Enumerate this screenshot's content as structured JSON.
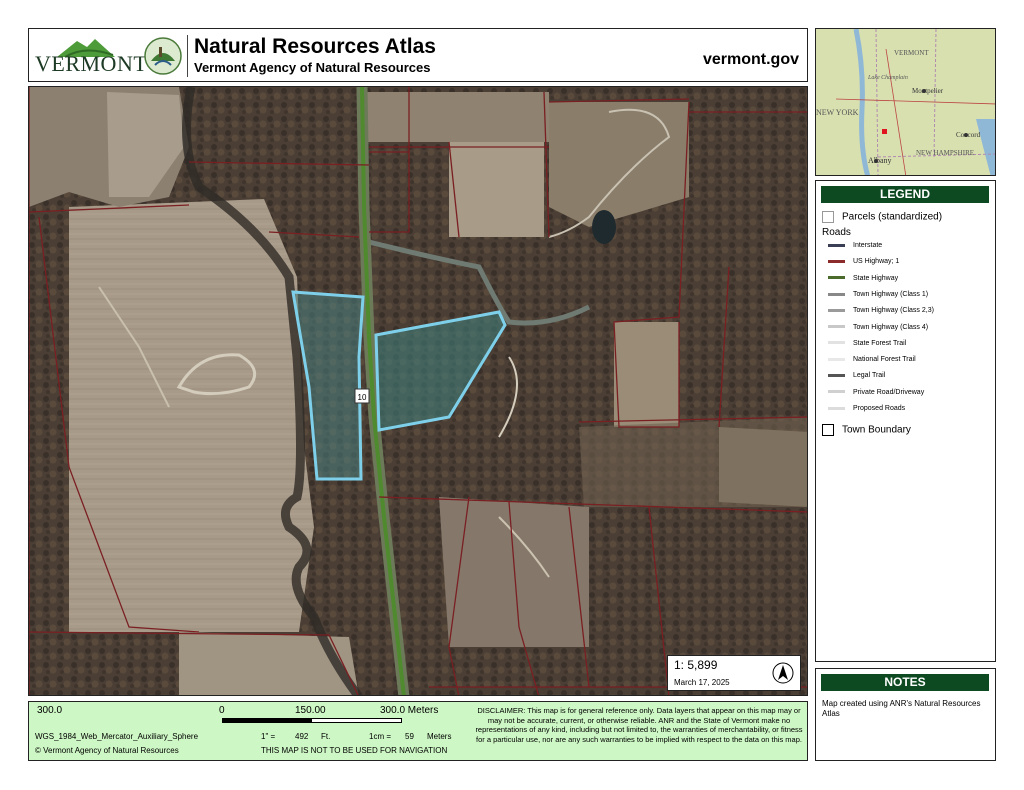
{
  "header": {
    "logo_text": "VERMONT",
    "title": "Natural Resources Atlas",
    "subtitle": "Vermont Agency of Natural Resources",
    "website": "vermont.gov"
  },
  "map": {
    "scale_ratio": "1:  5,899",
    "date": "March 17, 2025",
    "road_marker": "10"
  },
  "inset": {
    "labels": [
      "VERMONT",
      "Lake Champlain",
      "Montpelier",
      "NEW YORK",
      "Concord",
      "NEW HAMPSHIRE",
      "Albany"
    ]
  },
  "legend": {
    "title": "LEGEND",
    "parcels_label": "Parcels (standardized)",
    "roads_label": "Roads",
    "items": [
      {
        "label": "Interstate",
        "color": "#3a3f55"
      },
      {
        "label": "US Highway; 1",
        "color": "#8b2b2b"
      },
      {
        "label": "State Highway",
        "color": "#4a6b2b"
      },
      {
        "label": "Town Highway (Class 1)",
        "color": "#888888"
      },
      {
        "label": "Town Highway (Class 2,3)",
        "color": "#9a9a9a"
      },
      {
        "label": "Town Highway (Class 4)",
        "color": "#c8c8c8"
      },
      {
        "label": "State Forest Trail",
        "color": "#e2e2e2"
      },
      {
        "label": "National Forest Trail",
        "color": "#e8e8e8"
      },
      {
        "label": "Legal Trail",
        "color": "#555555"
      },
      {
        "label": "Private Road/Driveway",
        "color": "#d0d0d0"
      },
      {
        "label": "Proposed Roads",
        "color": "#dcdcdc"
      }
    ],
    "town_boundary_label": "Town Boundary"
  },
  "notes": {
    "title": "NOTES",
    "text": "Map created using ANR's Natural Resources Atlas"
  },
  "footer": {
    "scale_left": "300.0",
    "scale_zero": "0",
    "scale_mid": "150.00",
    "scale_right": "300.0 Meters",
    "projection": "WGS_1984_Web_Mercator_Auxiliary_Sphere",
    "copyright": "© Vermont Agency of Natural Resources",
    "inch_label": "1\" =",
    "inch_value": "492",
    "inch_unit": "Ft.",
    "cm_label": "1cm =",
    "cm_value": "59",
    "cm_unit": "Meters",
    "navigation_warning": "THIS MAP IS NOT TO BE USED FOR NAVIGATION",
    "disclaimer": "DISCLAIMER: This map is for general reference only. Data layers that appear on this map may or may not be accurate, current, or otherwise reliable. ANR and the State of Vermont make no representations of any kind, including but not limited to, the warranties of merchantability, or fitness for a particular use, nor are any such warranties to be implied with respect to the data on this map."
  }
}
